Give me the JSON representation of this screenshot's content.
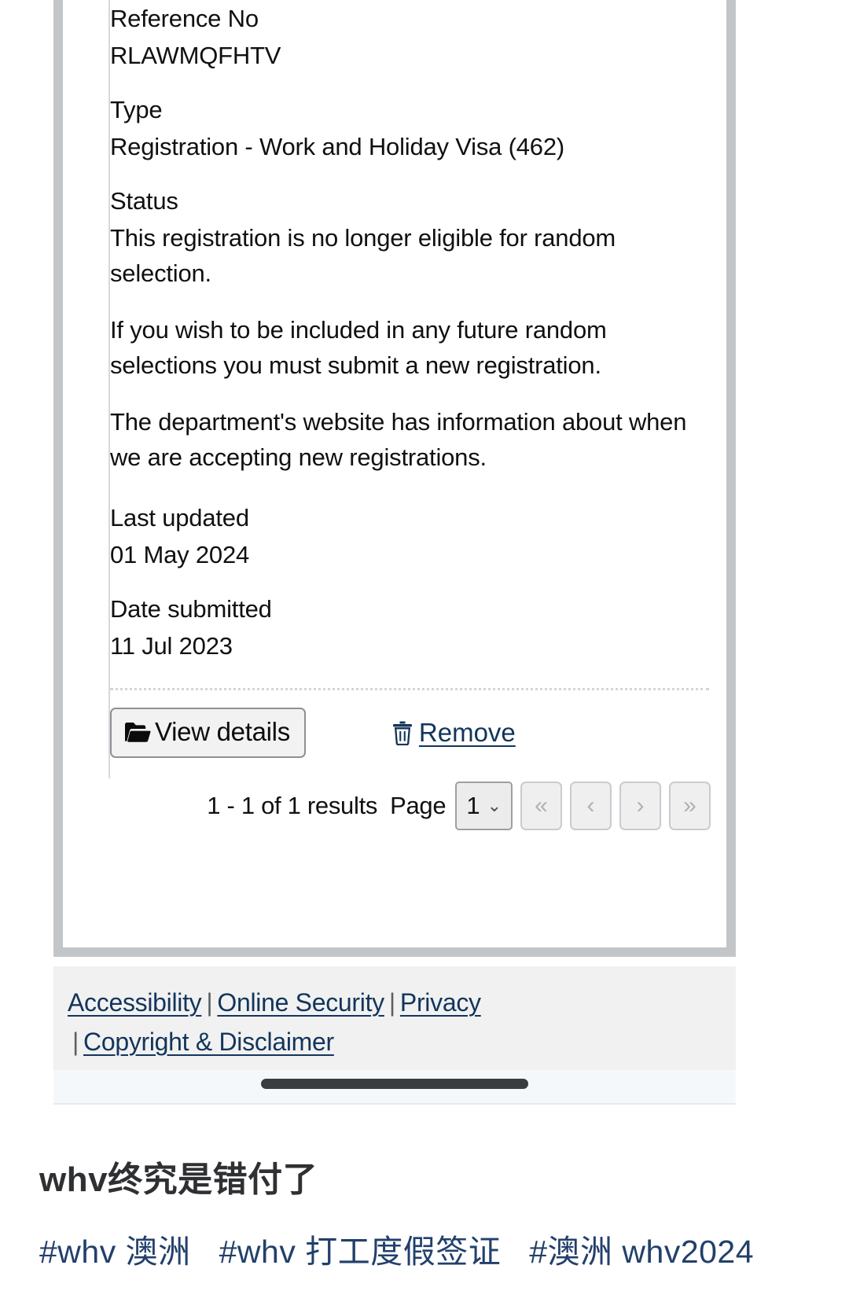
{
  "screenshot": {
    "result": {
      "reference_label": "Reference No",
      "reference_value": "RLAWMQFHTV",
      "type_label": "Type",
      "type_value": "Registration - Work and Holiday Visa (462)",
      "status_label": "Status",
      "status_paragraphs": [
        "This registration is no longer eligible for random selection.",
        "If you wish to be included in any future random selections you must submit a new registration.",
        "The department's website has information about when we are accepting new registrations."
      ],
      "last_updated_label": "Last updated",
      "last_updated_value": "01 May 2024",
      "date_submitted_label": "Date submitted",
      "date_submitted_value": "11 Jul 2023"
    },
    "actions": {
      "view_details_label": "View details",
      "remove_label": "Remove"
    },
    "pagination": {
      "results_text": "1 - 1 of 1 results",
      "page_word": "Page",
      "current_page": "1",
      "first_glyph": "«",
      "prev_glyph": "‹",
      "next_glyph": "›",
      "last_glyph": "»"
    },
    "footer": {
      "links_line1": [
        "Accessibility",
        "Online Security",
        "Privacy"
      ],
      "links_line2": [
        "Copyright & Disclaimer"
      ],
      "separator": "|"
    }
  },
  "caption": {
    "title": "whv终究是错付了",
    "tags": [
      "#whv 澳洲",
      "#whv 打工度假签证",
      "#澳洲 whv2024"
    ]
  },
  "colors": {
    "link": "#12355b",
    "frame": "#c3c6c9",
    "footer_bg": "#f1f1f1",
    "tag_color": "#22406b"
  }
}
